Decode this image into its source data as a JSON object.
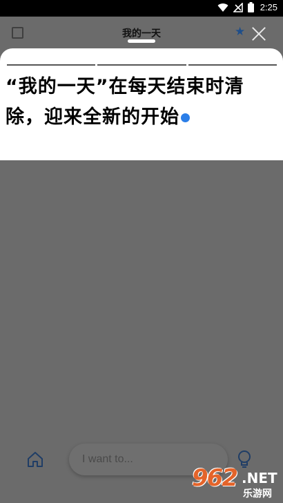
{
  "status_bar": {
    "time": "2:25",
    "icons": [
      "wifi-icon",
      "no-signal-icon",
      "battery-icon"
    ]
  },
  "header": {
    "title": "我的一天",
    "left_icon": "checkbox-icon",
    "right_icons": [
      "star-icon",
      "close-icon"
    ]
  },
  "sheet": {
    "message": "“我的一天”在每天结束时清除，迎来全新的开始"
  },
  "bottom_bar": {
    "input_placeholder": "I want to...",
    "left_icon": "home-icon",
    "right_icon": "lightbulb-icon"
  },
  "watermark": {
    "logo": "962",
    "net": ".NET",
    "sub": "乐游网"
  },
  "colors": {
    "accent": "#2b7ee8",
    "overlay": "#6b6b6b",
    "star": "#1e4e8a",
    "watermark": "#e4642a"
  }
}
